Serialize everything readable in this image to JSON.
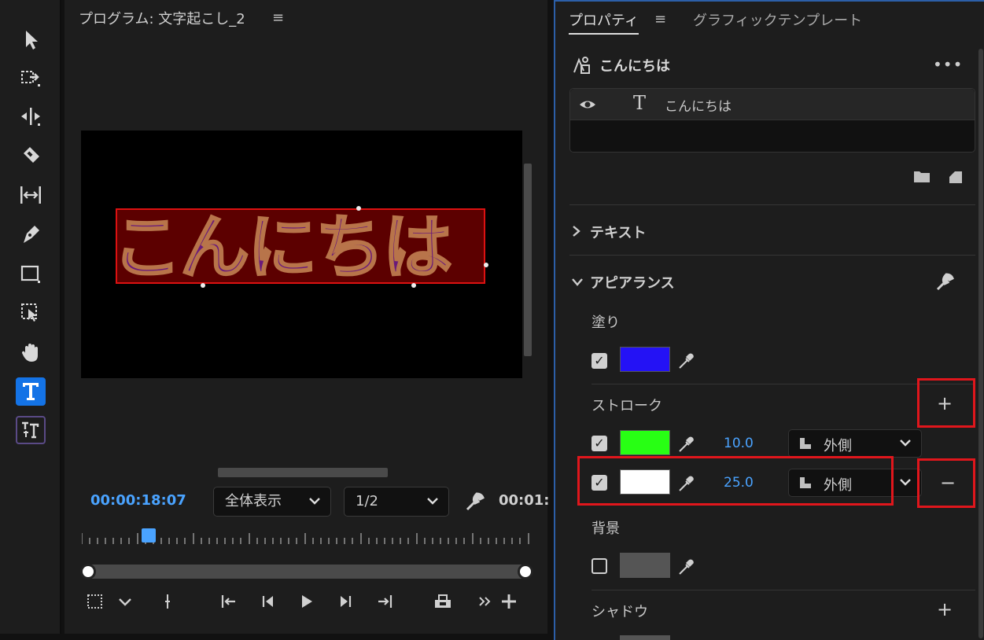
{
  "toolbar": {
    "tools": [
      "selection-tool",
      "track-select-tool",
      "ripple-edit-tool",
      "razor-tool",
      "slip-tool",
      "pen-tool",
      "rectangle-tool",
      "select-region-tool",
      "hand-tool",
      "type-tool",
      "vertical-type-tool"
    ],
    "active_tool": "type-tool"
  },
  "monitor": {
    "title": "プログラム: 文字起こし_2",
    "menu_icon": "≡",
    "overlay_text": "こんにちは",
    "timecode": "00:00:18:07",
    "zoom": "全体表示",
    "resolution": "1/2",
    "end_time": "00:01:",
    "accent_color": "#4aa3ff"
  },
  "properties": {
    "tab_properties": "プロパティ",
    "tab_menu_icon": "≡",
    "tab_graphic_template": "グラフィックテンプレート",
    "layer_title": "こんにちは",
    "more_icon": "•••",
    "layer_item_name": "こんにちは",
    "section_text": "テキスト",
    "section_appearance": "アピアランス",
    "fill_label": "塗り",
    "fill_color": "#2412f5",
    "stroke_label": "ストローク",
    "strokes": [
      {
        "color": "#28ff14",
        "width": "10.0",
        "position": "外側"
      },
      {
        "color": "#ffffff",
        "width": "25.0",
        "position": "外側"
      }
    ],
    "background_label": "背景",
    "background_color": "#555555",
    "shadow_label": "シャドウ",
    "plus_symbol": "+",
    "minus_symbol": "−"
  },
  "highlight_color": "#e0161c"
}
